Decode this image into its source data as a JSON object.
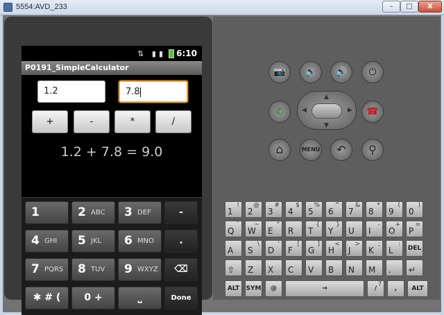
{
  "window": {
    "title": "5554:AVD_233",
    "min_label": "–",
    "max_label": "□",
    "close_label": "X"
  },
  "status": {
    "signal_glyph": "⇅ ▮▮",
    "time": "6:10"
  },
  "app": {
    "title": "P0191_SimpleCalculator"
  },
  "inputs": {
    "num1": "1.2",
    "num2": "7.8"
  },
  "ops": [
    "+",
    "-",
    "*",
    "/"
  ],
  "result": "1.2 + 7.8 = 9.0",
  "keypad": {
    "rows": [
      [
        {
          "big": "1",
          "small": ""
        },
        {
          "big": "2",
          "small": "ABC"
        },
        {
          "big": "3",
          "small": "DEF"
        },
        {
          "big": "-",
          "small": ""
        }
      ],
      [
        {
          "big": "4",
          "small": "GHI"
        },
        {
          "big": "5",
          "small": "JKL"
        },
        {
          "big": "6",
          "small": "MNO"
        },
        {
          "big": ".",
          "small": ""
        }
      ],
      [
        {
          "big": "7",
          "small": "PQRS"
        },
        {
          "big": "8",
          "small": "TUV"
        },
        {
          "big": "9",
          "small": "WXYZ"
        },
        {
          "big": "⌫",
          "small": ""
        }
      ],
      [
        {
          "big": "✱ # (",
          "small": ""
        },
        {
          "big": "0 +",
          "small": ""
        },
        {
          "big": "⎵",
          "small": ""
        },
        {
          "big": "Done",
          "small": ""
        }
      ]
    ]
  },
  "controls": {
    "camera": "📷",
    "vol_down": "🔉",
    "vol_up": "🔊",
    "power": "⏻",
    "call": "✆",
    "end_call": "☎",
    "home": "⌂",
    "menu": "MENU",
    "back": "↶",
    "search": "⚲",
    "up": "▲",
    "down": "▼",
    "left": "◀",
    "right": "▶"
  },
  "qwerty": {
    "row1": [
      [
        "1",
        "!"
      ],
      [
        "2",
        "@"
      ],
      [
        "3",
        "#"
      ],
      [
        "4",
        "$"
      ],
      [
        "5",
        "%"
      ],
      [
        "6",
        "^"
      ],
      [
        "7",
        "&"
      ],
      [
        "8",
        "*"
      ],
      [
        "9",
        "("
      ],
      [
        "0",
        ")"
      ]
    ],
    "row2": [
      [
        "Q",
        "`"
      ],
      [
        "W",
        "~"
      ],
      [
        "E",
        "\""
      ],
      [
        "R",
        ""
      ],
      [
        "T",
        "{"
      ],
      [
        "Y",
        "}"
      ],
      [
        "U",
        ""
      ],
      [
        "I",
        "-"
      ],
      [
        "O",
        "+"
      ],
      [
        "P",
        "="
      ]
    ],
    "row3": [
      [
        "A",
        ""
      ],
      [
        "S",
        "\\"
      ],
      [
        "D",
        "'"
      ],
      [
        "F",
        "["
      ],
      [
        "G",
        "]"
      ],
      [
        "H",
        "<"
      ],
      [
        "J",
        ">"
      ],
      [
        "K",
        ";"
      ],
      [
        "L",
        ":"
      ],
      [
        "DEL",
        ""
      ]
    ],
    "row4": [
      [
        "⇧",
        ""
      ],
      [
        "Z",
        ""
      ],
      [
        "X",
        ""
      ],
      [
        "C",
        ""
      ],
      [
        "V",
        ""
      ],
      [
        "B",
        ""
      ],
      [
        "N",
        ""
      ],
      [
        "M",
        ""
      ],
      [
        ".",
        ""
      ],
      [
        "↵",
        ""
      ]
    ],
    "row5": [
      [
        "ALT",
        ""
      ],
      [
        "SYM",
        ""
      ],
      [
        "@",
        ""
      ],
      [
        "→",
        ""
      ],
      [
        "/",
        "?"
      ],
      [
        ",",
        ""
      ],
      [
        "ALT",
        ""
      ]
    ]
  }
}
